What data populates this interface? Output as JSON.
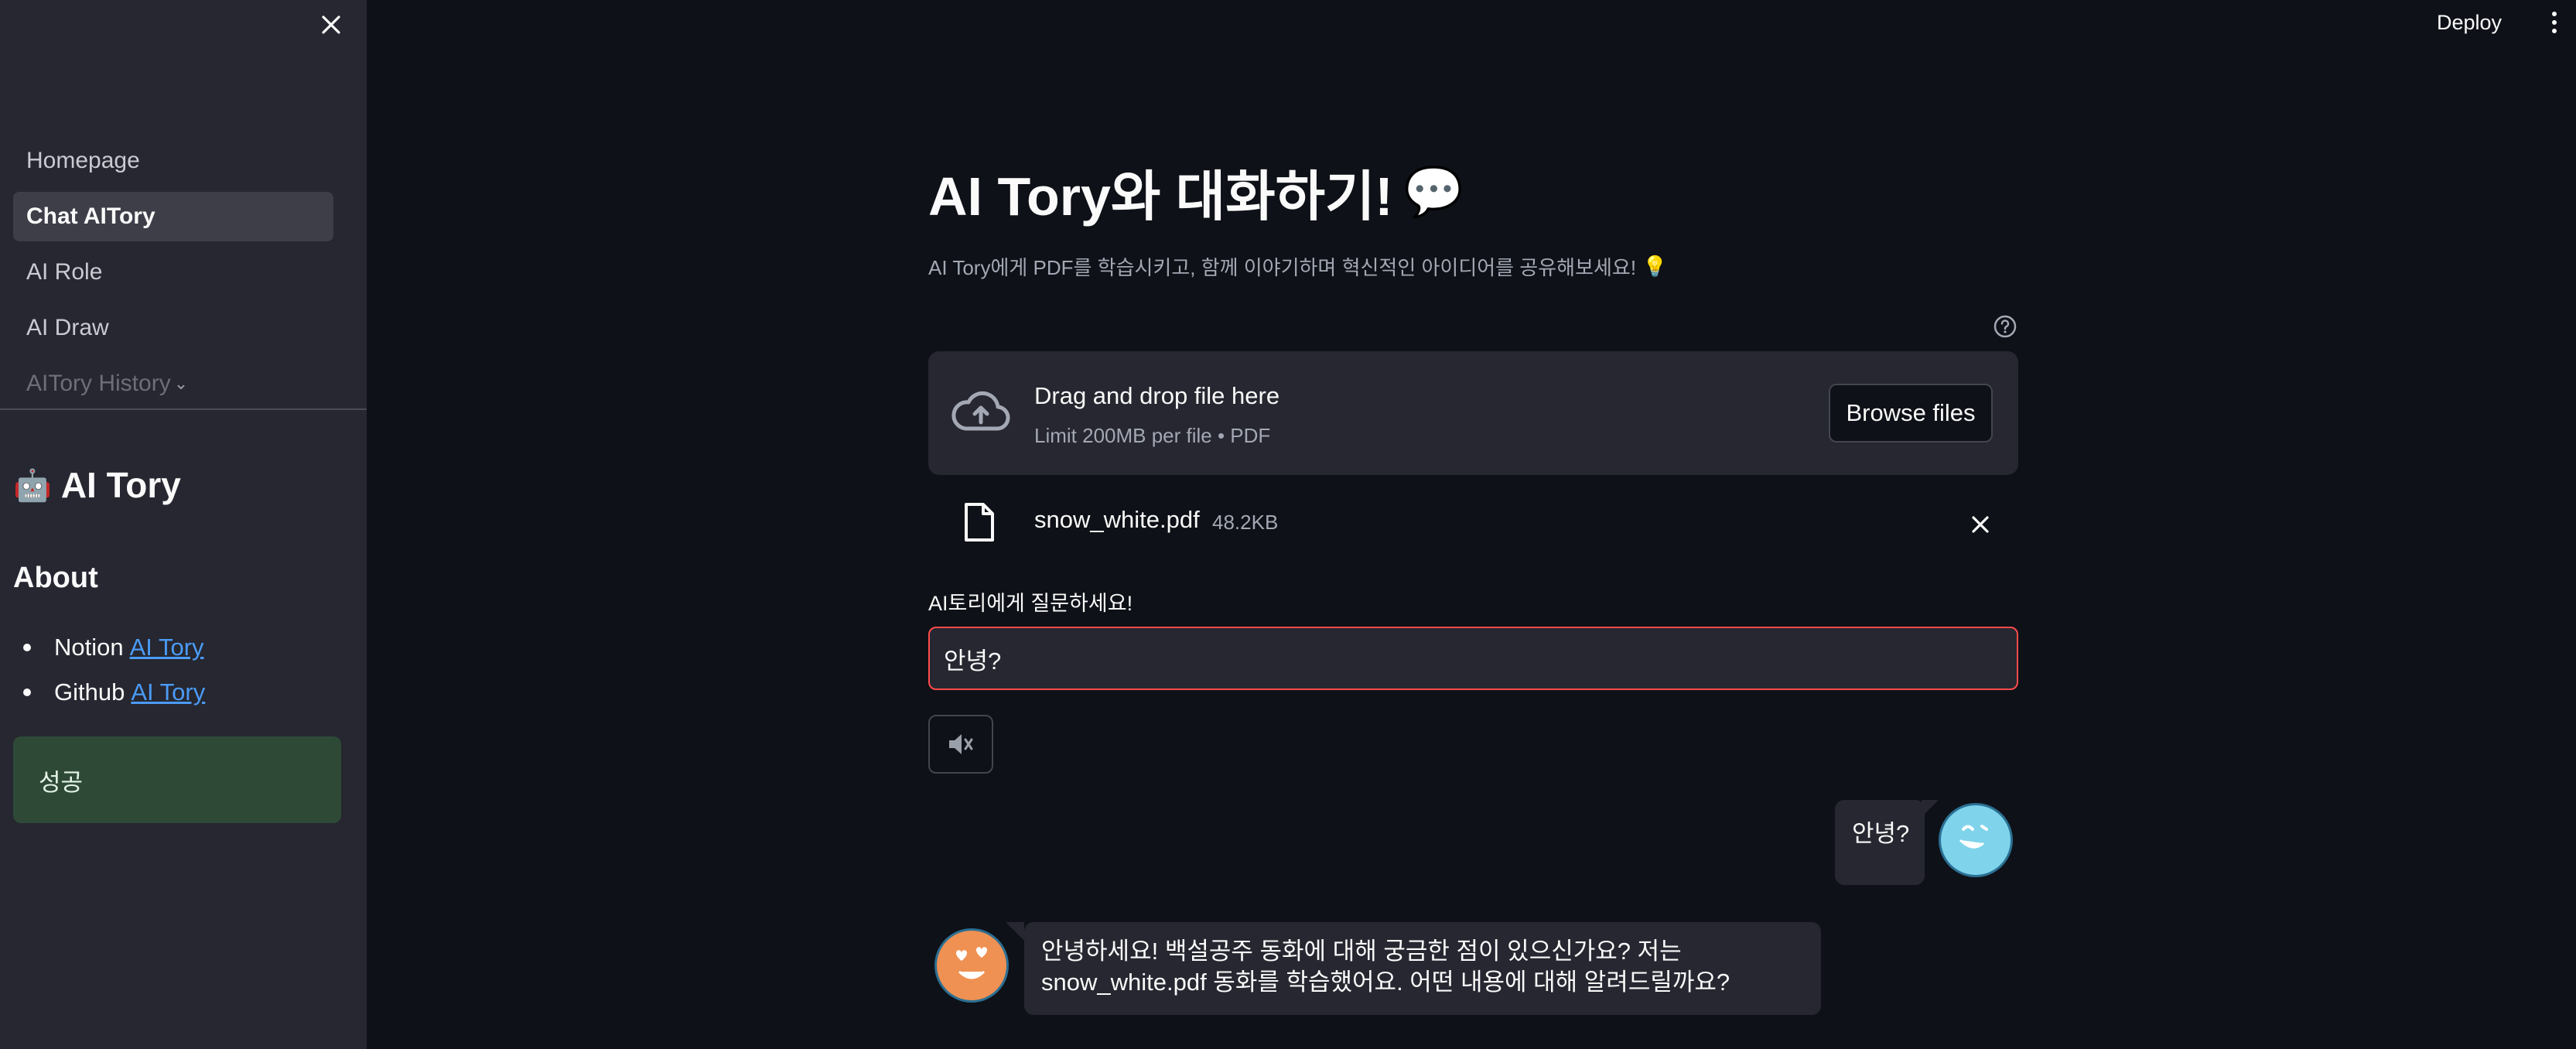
{
  "sidebar": {
    "nav_items": [
      {
        "label": "Homepage"
      },
      {
        "label": "Chat AITory"
      },
      {
        "label": "AI Role"
      },
      {
        "label": "AI Draw"
      },
      {
        "label": "AITory History"
      }
    ],
    "brand_emoji": "🤖",
    "brand_title": "AI Tory",
    "about_title": "About",
    "about_links": [
      {
        "prefix": "Notion",
        "link": "AI Tory"
      },
      {
        "prefix": "Github",
        "link": "AI Tory"
      }
    ],
    "success_text": "성공"
  },
  "header": {
    "deploy_label": "Deploy"
  },
  "main": {
    "title": "AI Tory와 대화하기!",
    "title_emoji": "💬",
    "subtitle": "AI Tory에게 PDF를 학습시키고, 함께 이야기하며 혁신적인 아이디어를 공유해보세요!",
    "subtitle_emoji": "💡",
    "uploader": {
      "drop_title": "Drag and drop file here",
      "limit_text": "Limit 200MB per file • PDF",
      "browse_label": "Browse files"
    },
    "file": {
      "name": "snow_white.pdf",
      "size": "48.2KB"
    },
    "ask_label": "AI토리에게 질문하세요!",
    "ask_value": "안녕?"
  },
  "chat": {
    "messages": [
      {
        "role": "user",
        "text": "안녕?"
      },
      {
        "role": "assistant",
        "line1": "안녕하세요! 백설공주 동화에 대해 궁금한 점이 있으신가요? 저는",
        "line2": "snow_white.pdf 동화를 학습했어요. 어떤 내용에 대해 알려드릴까요?"
      }
    ]
  },
  "colors": {
    "background": "#0e1117",
    "sidebar": "#262730",
    "accent_red": "#ff4b4b",
    "link_blue": "#4b9bf5",
    "success_bg": "#2e4a37"
  }
}
